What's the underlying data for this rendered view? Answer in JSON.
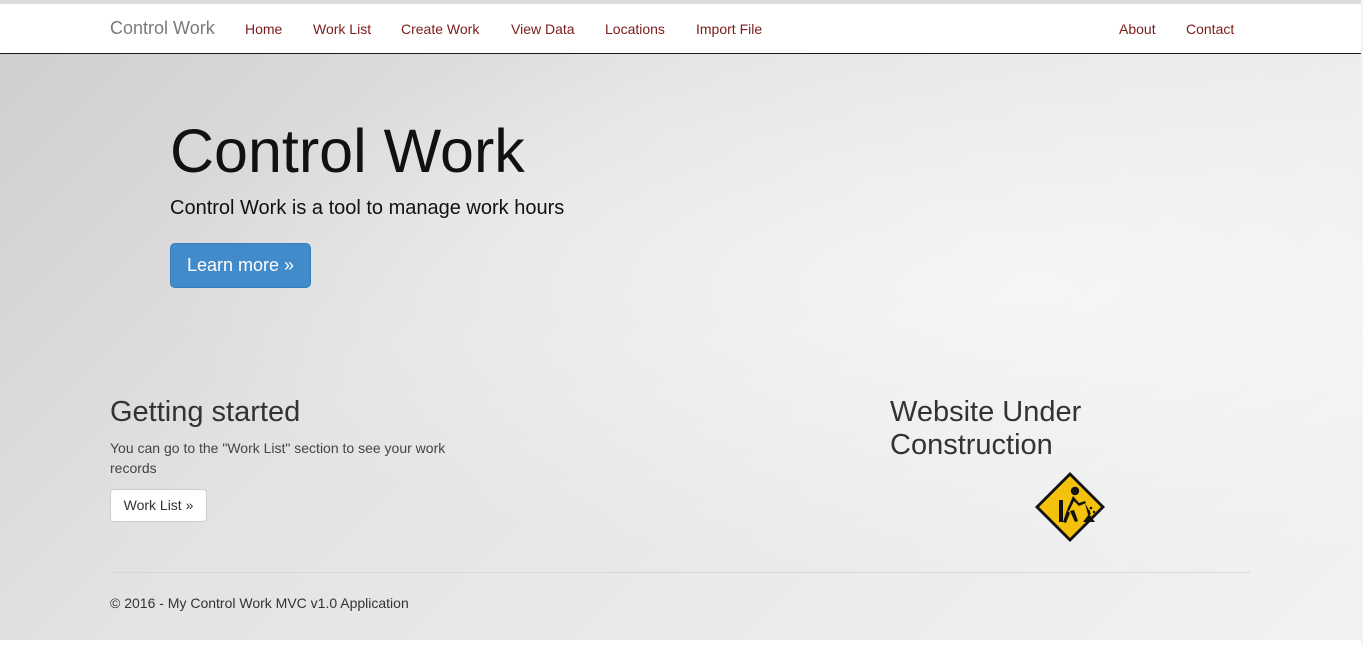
{
  "navbar": {
    "brand": "Control Work",
    "links": [
      "Home",
      "Work List",
      "Create Work",
      "View Data",
      "Locations",
      "Import File"
    ],
    "right_links": [
      "About",
      "Contact"
    ]
  },
  "hero": {
    "title": "Control Work",
    "lead": "Control Work is a tool to manage work hours",
    "button_label": "Learn more »"
  },
  "getting_started": {
    "heading": "Getting started",
    "text": "You can go to the \"Work List\" section to see your work records",
    "button_label": "Work List »"
  },
  "construction": {
    "heading_line1": "Website Under",
    "heading_line2": "Construction",
    "icon": "under-construction-sign"
  },
  "footer": {
    "text": "© 2016 - My Control Work MVC v1.0 Application"
  },
  "colors": {
    "nav_link": "#7b1b1b",
    "primary_button": "#428bca",
    "sign_yellow": "#f4c20d"
  }
}
